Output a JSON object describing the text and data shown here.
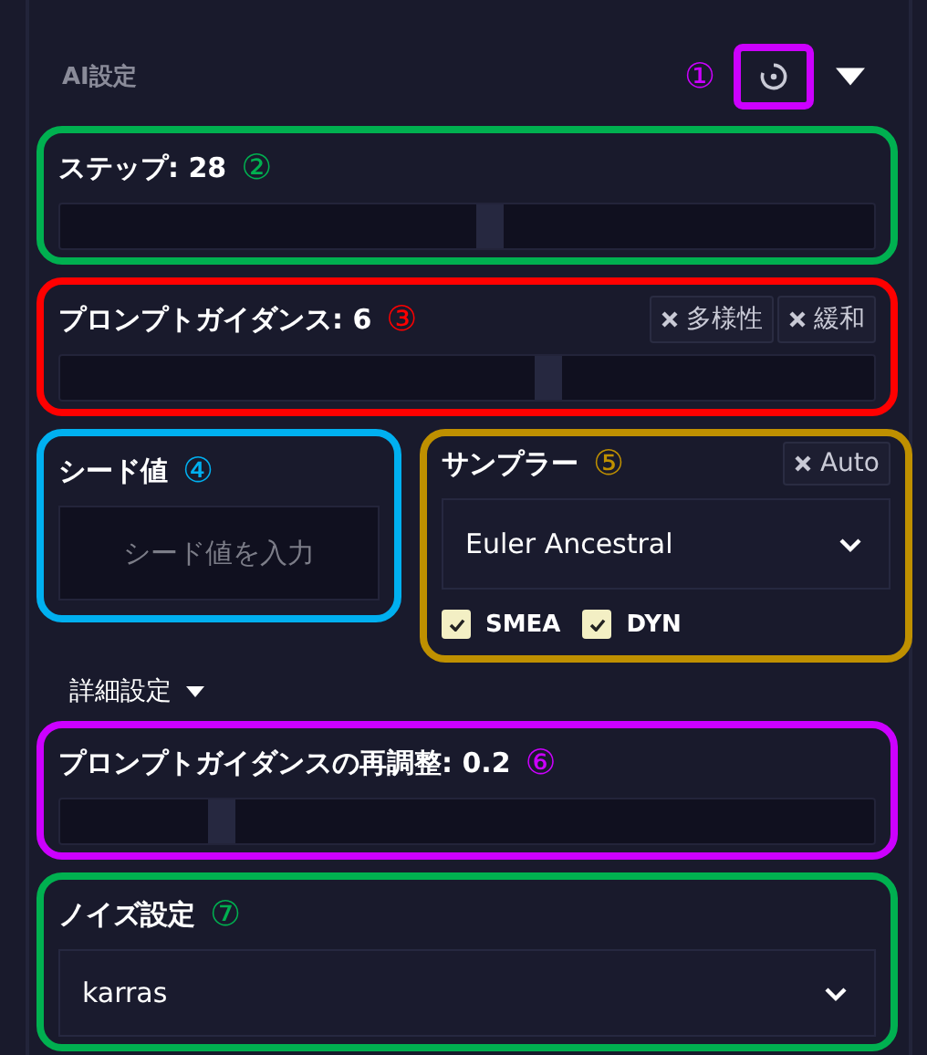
{
  "panel": {
    "title": "AI設定",
    "reset": {
      "marker": "①",
      "color": "#cc00ff"
    },
    "expanded": true
  },
  "sections": [
    {
      "kind": "slider",
      "marker": "②",
      "color": "#00b050",
      "label": "ステップ: 28",
      "level": 0.53
    },
    {
      "kind": "slider",
      "marker": "③",
      "color": "#ff0000",
      "label": "プロンプトガイダンス: 6",
      "level": 0.6,
      "chips": [
        "多様性",
        "緩和"
      ]
    },
    {
      "kind": "pair",
      "items": [
        {
          "kind": "seed",
          "marker": "④",
          "color": "#00b0f0",
          "label": "シード値",
          "placeholder": "シード値を入力"
        },
        {
          "kind": "sampler",
          "marker": "⑤",
          "color": "#bf9000",
          "label": "サンプラー",
          "chips": [
            "Auto"
          ],
          "value": "Euler Ancestral",
          "options": [
            {
              "label": "SMEA",
              "checked": true
            },
            {
              "label": "DYN",
              "checked": true
            }
          ]
        }
      ]
    },
    {
      "kind": "details",
      "label": "詳細設定",
      "expanded": true
    },
    {
      "kind": "slider",
      "marker": "⑥",
      "color": "#cc00ff",
      "label": "プロンプトガイダンスの再調整: 0.2",
      "level": 0.2
    },
    {
      "kind": "select",
      "marker": "⑦",
      "color": "#00b050",
      "label": "ノイズ設定",
      "value": "karras"
    }
  ]
}
